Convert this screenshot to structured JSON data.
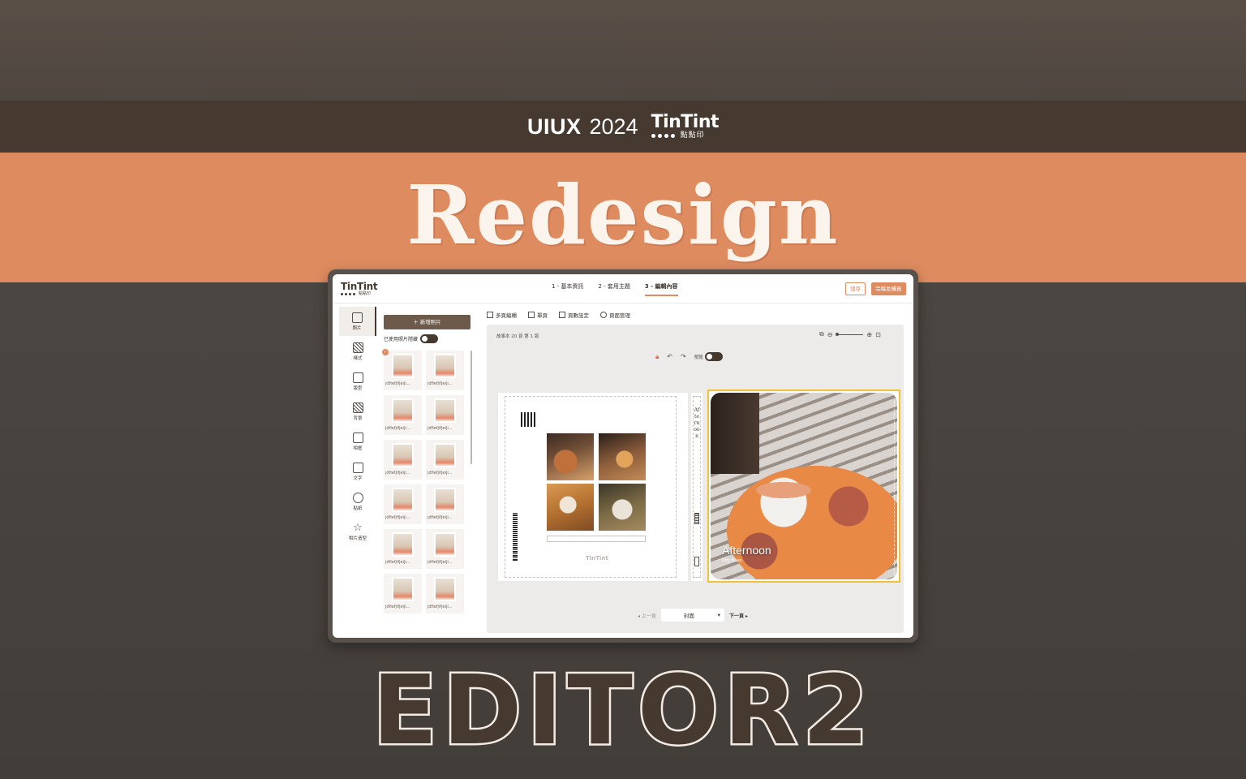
{
  "banner": {
    "uiux": "UIUX",
    "year": "2024",
    "brand_word": "TinTint",
    "brand_zh": "點點印",
    "headline": "Redesign",
    "footer_title": "EDITOR2"
  },
  "app": {
    "logo_word": "TinTint",
    "logo_zh": "點點印",
    "steps": [
      {
        "label": "1 - 基本資訊"
      },
      {
        "label": "2 - 套用主題"
      },
      {
        "label": "3 - 編輯內容"
      }
    ],
    "save_label": "儲存",
    "done_label": "完稿並購買",
    "sidebar": [
      {
        "label": "照片",
        "icon": "image-icon"
      },
      {
        "label": "樣式",
        "icon": "pattern-icon"
      },
      {
        "label": "版型",
        "icon": "layout-icon"
      },
      {
        "label": "背景",
        "icon": "background-icon"
      },
      {
        "label": "相框",
        "icon": "frame-icon"
      },
      {
        "label": "文字",
        "icon": "text-icon"
      },
      {
        "label": "貼紙",
        "icon": "sticker-icon"
      },
      {
        "label": "相片造型",
        "icon": "star-icon"
      }
    ],
    "photo_panel": {
      "add_label": "＋  新增照片",
      "hide_used_label": "已使用照片隱藏",
      "thumb_name": "jdfiefjifjeiji..."
    },
    "toolbar": [
      {
        "label": "多頁編輯"
      },
      {
        "label": "單頁"
      },
      {
        "label": "頁數設定"
      },
      {
        "label": "頁面管理"
      }
    ],
    "canvas": {
      "book_info": "故事本 20 頁 第 1 版",
      "preview_label": "預覽",
      "spine_text": "Afternoon",
      "cover_title": "Afternoon",
      "cover_subtitle": "Elty Kuan",
      "mini_logo": "TinTint"
    },
    "pager": {
      "prev_label": "上一頁",
      "current": "封面",
      "next_label": "下一頁"
    }
  },
  "colors": {
    "accent": "#de8b60",
    "brand_dark": "#463930",
    "highlight": "#f0c23a"
  }
}
